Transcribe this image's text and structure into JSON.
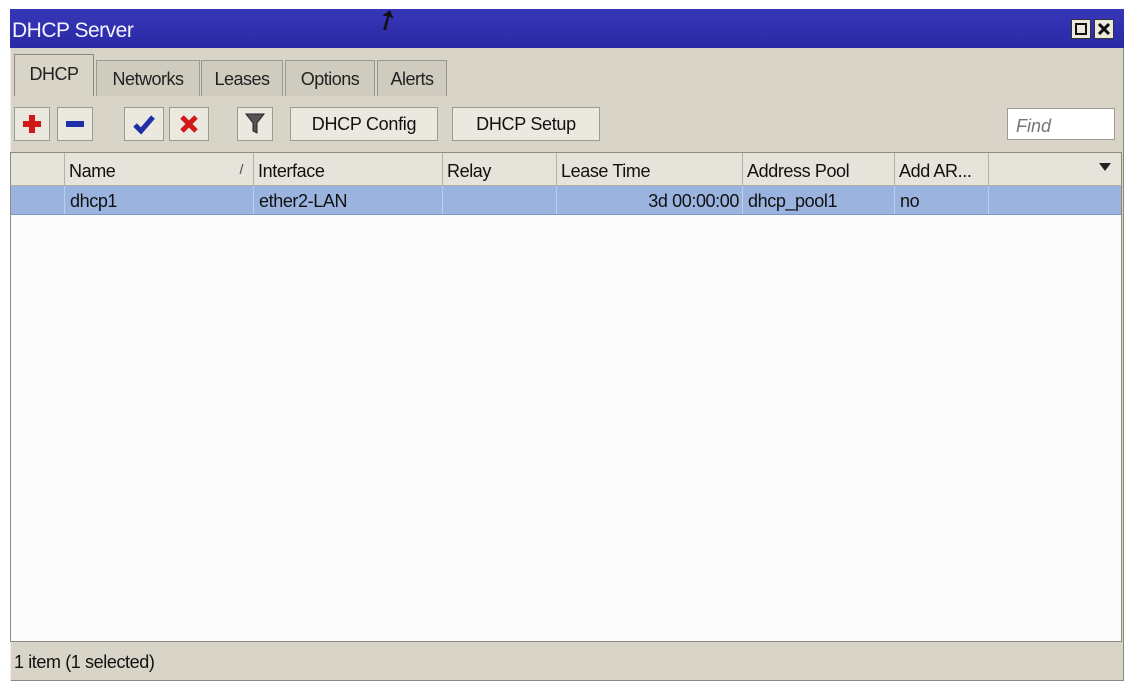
{
  "window": {
    "title": "DHCP Server"
  },
  "tabs": [
    {
      "label": "DHCP",
      "active": true
    },
    {
      "label": "Networks"
    },
    {
      "label": "Leases"
    },
    {
      "label": "Options"
    },
    {
      "label": "Alerts"
    }
  ],
  "toolbar": {
    "icons": [
      "add-icon",
      "remove-icon",
      "enable-icon",
      "disable-icon",
      "filter-icon"
    ],
    "dhcp_config_label": "DHCP Config",
    "dhcp_setup_label": "DHCP Setup",
    "find_placeholder": "Find"
  },
  "table": {
    "columns": [
      "Name",
      "Interface",
      "Relay",
      "Lease Time",
      "Address Pool",
      "Add AR..."
    ],
    "rows": [
      {
        "name": "dhcp1",
        "interface": "ether2-LAN",
        "relay": "",
        "lease_time": "3d 00:00:00",
        "address_pool": "dhcp_pool1",
        "add_arp": "no"
      }
    ]
  },
  "status": {
    "text": "1 item (1 selected)"
  },
  "colors": {
    "titlebar": "#2e2eaa",
    "selected_row": "#9bb4df",
    "add": "#d01818",
    "enable": "#1f2fa8"
  }
}
